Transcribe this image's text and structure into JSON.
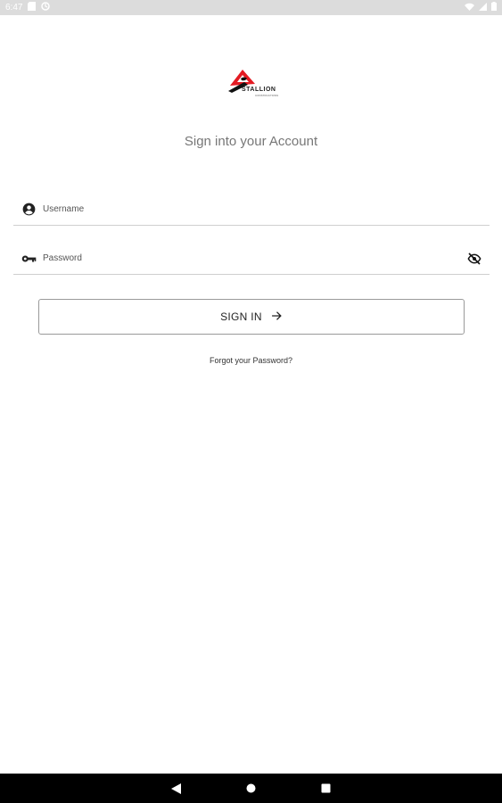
{
  "status_bar": {
    "time": "6:47",
    "left_icons": [
      "sd-card-icon",
      "sync-icon"
    ],
    "right_icons": [
      "wifi-icon",
      "signal-icon",
      "battery-icon"
    ]
  },
  "brand": {
    "logo_text": "STALLION",
    "logo_subtext": "CONSTRUCTIONS",
    "accent_color": "#e31b23"
  },
  "login": {
    "heading": "Sign into your Account",
    "username": {
      "placeholder": "Username",
      "value": "",
      "icon": "account-circle-icon"
    },
    "password": {
      "placeholder": "Password",
      "value": "",
      "icon": "key-icon",
      "toggle_icon": "visibility-off-icon"
    },
    "sign_in_label": "SIGN IN",
    "sign_in_icon": "arrow-right-icon",
    "forgot_label": "Forgot your Password?"
  },
  "nav_bar": {
    "buttons": [
      "back-icon",
      "home-icon",
      "recents-icon"
    ]
  }
}
